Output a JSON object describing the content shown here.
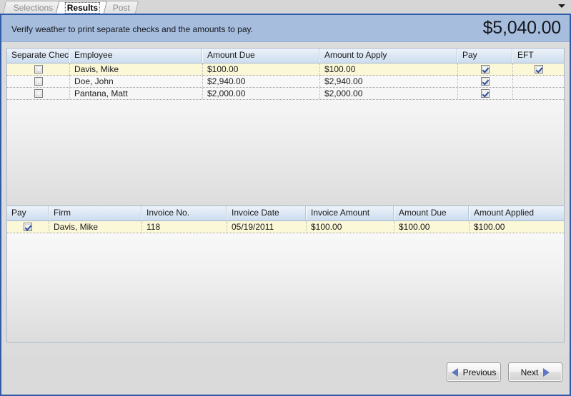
{
  "tabs": [
    {
      "label": "Selections",
      "active": false
    },
    {
      "label": "Results",
      "active": true
    },
    {
      "label": "Post",
      "active": false
    }
  ],
  "tab_overflow_icon": "chevron-down-icon",
  "header": {
    "instruction": "Verify weather to print separate checks and the amounts to pay.",
    "total": "$5,040.00"
  },
  "top_grid": {
    "columns": [
      "Separate Chec",
      "Employee",
      "Amount Due",
      "Amount to Apply",
      "Pay",
      "EFT"
    ],
    "rows": [
      {
        "separate_check": false,
        "employee": "Davis, Mike",
        "amount_due": "$100.00",
        "amount_to_apply": "$100.00",
        "pay": true,
        "eft": true,
        "selected": true
      },
      {
        "separate_check": false,
        "employee": "Doe, John",
        "amount_due": "$2,940.00",
        "amount_to_apply": "$2,940.00",
        "pay": true,
        "eft": false,
        "selected": false
      },
      {
        "separate_check": false,
        "employee": "Pantana, Matt",
        "amount_due": "$2,000.00",
        "amount_to_apply": "$2,000.00",
        "pay": true,
        "eft": false,
        "selected": false
      }
    ]
  },
  "bottom_grid": {
    "columns": [
      "Pay",
      "Firm",
      "Invoice No.",
      "Invoice Date",
      "Invoice Amount",
      "Amount Due",
      "Amount Applied"
    ],
    "rows": [
      {
        "pay": true,
        "firm": "Davis, Mike",
        "invoice_no": "118",
        "invoice_date": "05/19/2011",
        "invoice_amount": "$100.00",
        "amount_due": "$100.00",
        "amount_applied": "$100.00",
        "selected": true
      }
    ]
  },
  "footer": {
    "previous_label": "Previous",
    "next_label": "Next",
    "previous_icon": "triangle-left-icon",
    "next_icon": "triangle-right-icon"
  },
  "colors": {
    "band": "#a6bdde",
    "frame_border": "#2f5ba8",
    "selected_row": "#fbf8d8",
    "check_mark": "#2a4f9b",
    "arrow": "#5f76c4"
  }
}
